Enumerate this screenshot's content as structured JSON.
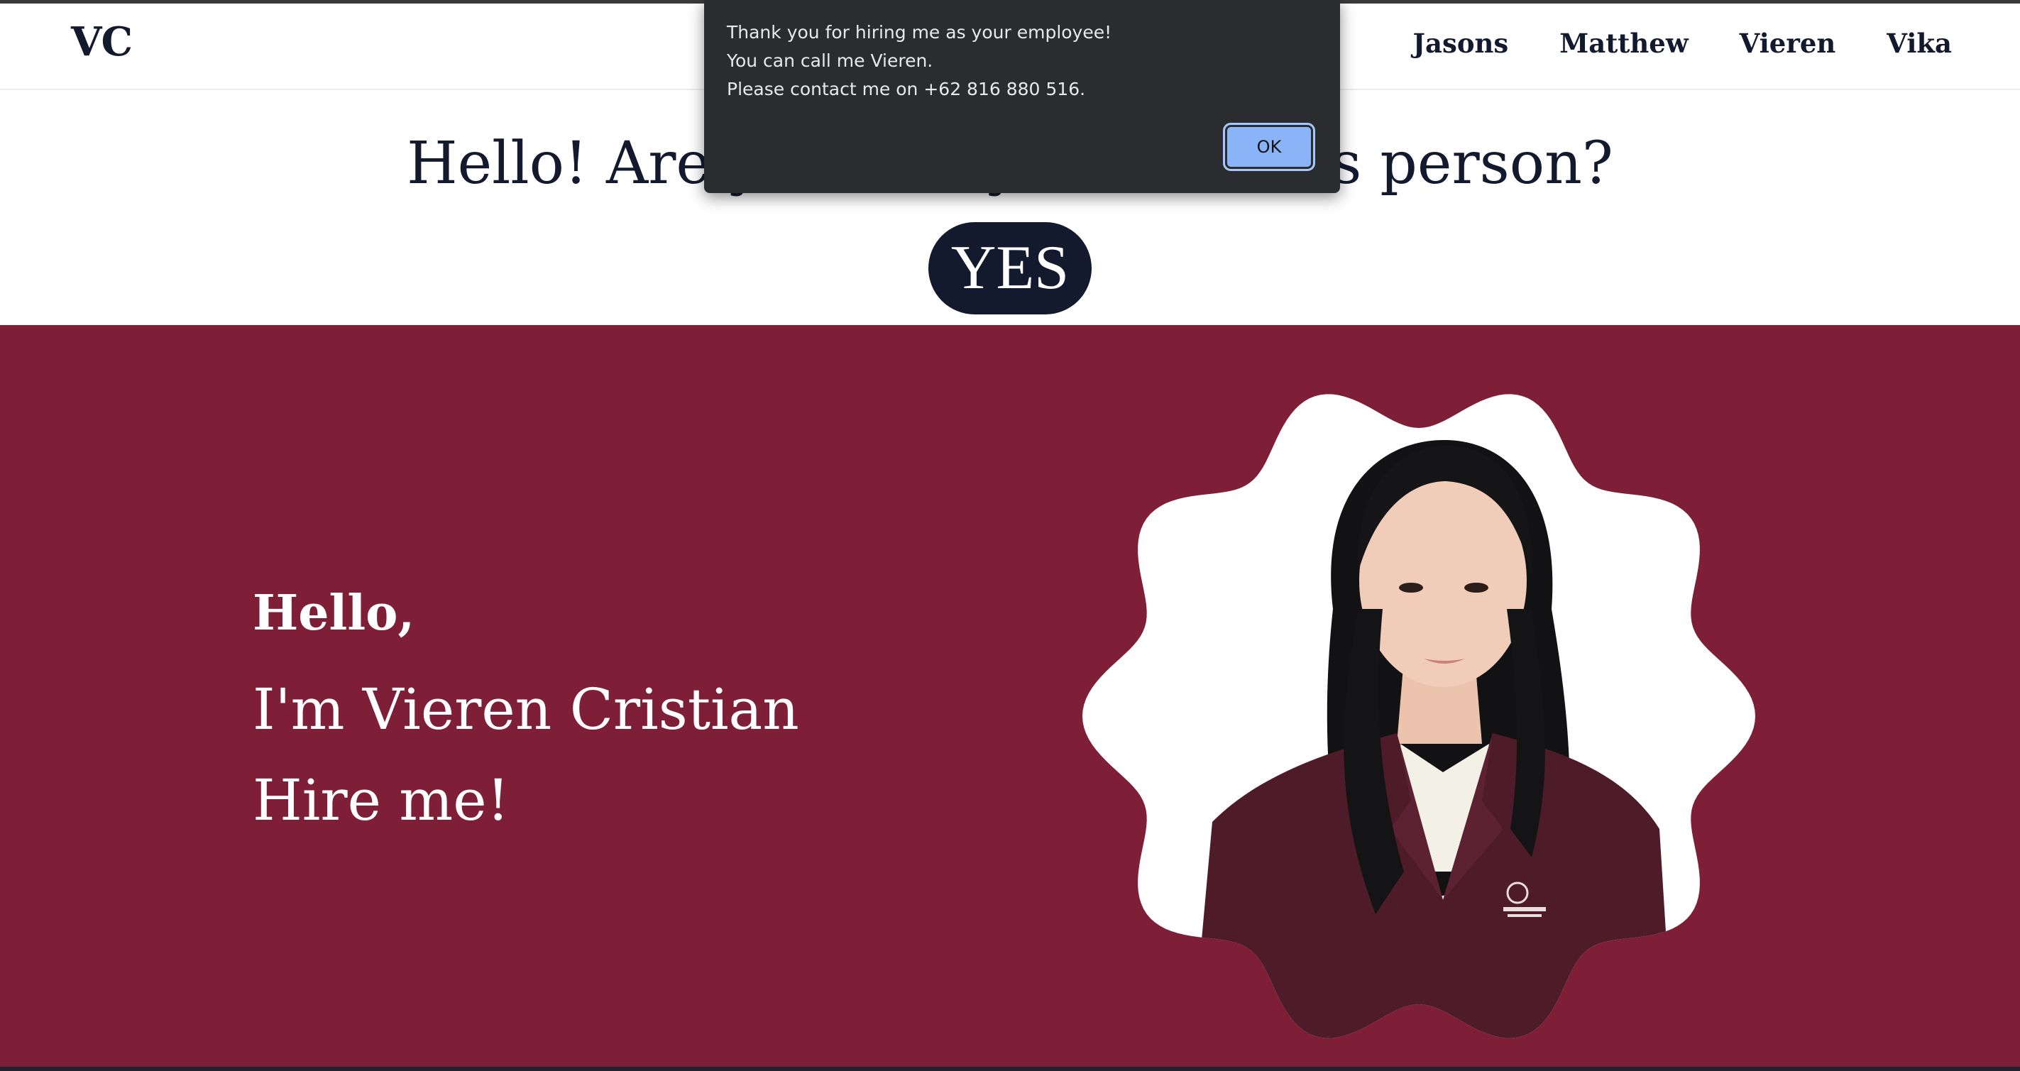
{
  "navbar": {
    "brand": "VC",
    "links": [
      "Jasons",
      "Matthew",
      "Vieren",
      "Vika"
    ]
  },
  "question": {
    "text": "Hello! Are you ready to hire this person?",
    "yes_label": "YES"
  },
  "hero": {
    "greeting": "Hello,",
    "name": "I'm Vieren Cristian",
    "cta": "Hire me!"
  },
  "dialog": {
    "lines": [
      "Thank you for hiring me as your employee!",
      "You can call me Vieren.",
      "Please contact me on +62 816 880 516."
    ],
    "ok_label": "OK"
  },
  "colors": {
    "navy": "#141a2e",
    "hero_bg": "#7e1f37",
    "dialog_bg": "#2b2c30",
    "ok_button": "#8ab4f8"
  }
}
